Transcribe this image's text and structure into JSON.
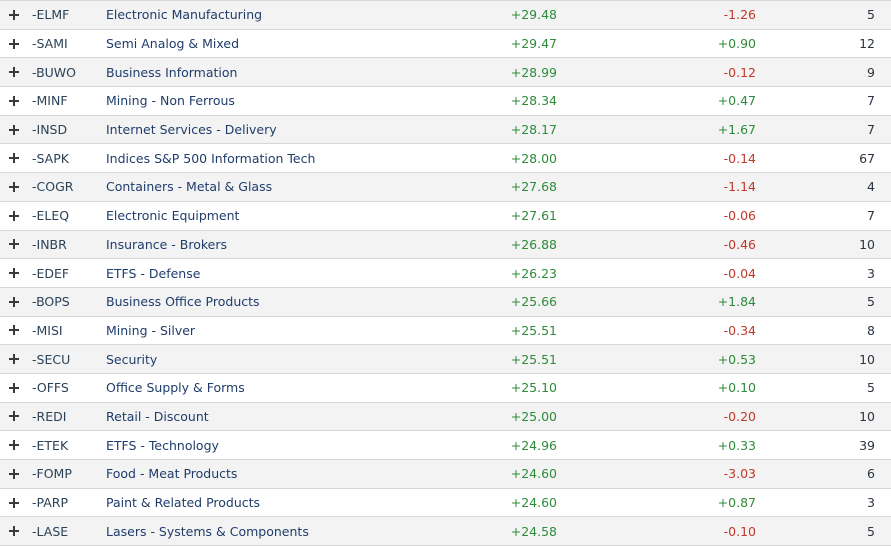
{
  "colors": {
    "positive": "#2e8b3a",
    "negative": "#c0392b",
    "row_alt": "#f3f3f3",
    "name_link": "#1f3d6b"
  },
  "rows": [
    {
      "symbol": "-ELMF",
      "name": "Electronic Manufacturing",
      "performance": "+29.48",
      "change": "-1.26",
      "change_dir": "neg",
      "count": "5"
    },
    {
      "symbol": "-SAMI",
      "name": "Semi Analog & Mixed",
      "performance": "+29.47",
      "change": "+0.90",
      "change_dir": "pos",
      "count": "12"
    },
    {
      "symbol": "-BUWO",
      "name": "Business Information",
      "performance": "+28.99",
      "change": "-0.12",
      "change_dir": "neg",
      "count": "9"
    },
    {
      "symbol": "-MINF",
      "name": "Mining - Non Ferrous",
      "performance": "+28.34",
      "change": "+0.47",
      "change_dir": "pos",
      "count": "7"
    },
    {
      "symbol": "-INSD",
      "name": "Internet Services - Delivery",
      "performance": "+28.17",
      "change": "+1.67",
      "change_dir": "pos",
      "count": "7"
    },
    {
      "symbol": "-SAPK",
      "name": "Indices S&P 500 Information Tech",
      "performance": "+28.00",
      "change": "-0.14",
      "change_dir": "neg",
      "count": "67"
    },
    {
      "symbol": "-COGR",
      "name": "Containers - Metal & Glass",
      "performance": "+27.68",
      "change": "-1.14",
      "change_dir": "neg",
      "count": "4"
    },
    {
      "symbol": "-ELEQ",
      "name": "Electronic Equipment",
      "performance": "+27.61",
      "change": "-0.06",
      "change_dir": "neg",
      "count": "7"
    },
    {
      "symbol": "-INBR",
      "name": "Insurance - Brokers",
      "performance": "+26.88",
      "change": "-0.46",
      "change_dir": "neg",
      "count": "10"
    },
    {
      "symbol": "-EDEF",
      "name": "ETFS - Defense",
      "performance": "+26.23",
      "change": "-0.04",
      "change_dir": "neg",
      "count": "3"
    },
    {
      "symbol": "-BOPS",
      "name": "Business Office Products",
      "performance": "+25.66",
      "change": "+1.84",
      "change_dir": "pos",
      "count": "5"
    },
    {
      "symbol": "-MISI",
      "name": "Mining - Silver",
      "performance": "+25.51",
      "change": "-0.34",
      "change_dir": "neg",
      "count": "8"
    },
    {
      "symbol": "-SECU",
      "name": "Security",
      "performance": "+25.51",
      "change": "+0.53",
      "change_dir": "pos",
      "count": "10"
    },
    {
      "symbol": "-OFFS",
      "name": "Office Supply & Forms",
      "performance": "+25.10",
      "change": "+0.10",
      "change_dir": "pos",
      "count": "5"
    },
    {
      "symbol": "-REDI",
      "name": "Retail - Discount",
      "performance": "+25.00",
      "change": "-0.20",
      "change_dir": "neg",
      "count": "10"
    },
    {
      "symbol": "-ETEK",
      "name": "ETFS - Technology",
      "performance": "+24.96",
      "change": "+0.33",
      "change_dir": "pos",
      "count": "39"
    },
    {
      "symbol": "-FOMP",
      "name": "Food - Meat Products",
      "performance": "+24.60",
      "change": "-3.03",
      "change_dir": "neg",
      "count": "6"
    },
    {
      "symbol": "-PARP",
      "name": "Paint & Related Products",
      "performance": "+24.60",
      "change": "+0.87",
      "change_dir": "pos",
      "count": "3"
    },
    {
      "symbol": "-LASE",
      "name": "Lasers - Systems & Components",
      "performance": "+24.58",
      "change": "-0.10",
      "change_dir": "neg",
      "count": "5"
    }
  ]
}
